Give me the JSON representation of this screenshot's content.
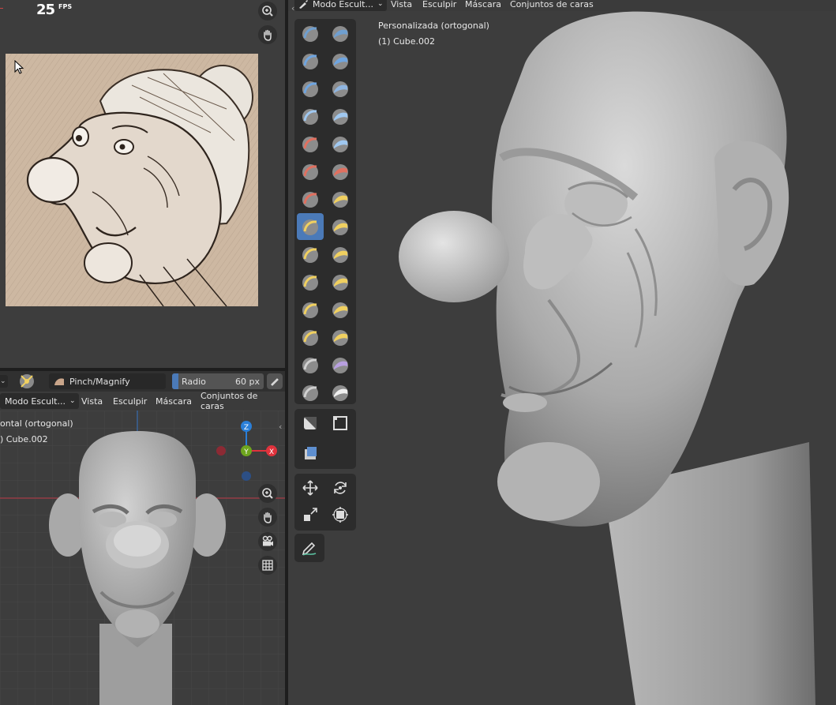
{
  "fps": {
    "value": "25",
    "unit": "FPS"
  },
  "left_bottom": {
    "brush_name": "Pinch/Magnify",
    "radius_label": "Radio",
    "radius_value": "60 px",
    "mode": "Modo Escult...",
    "menu": [
      "Vista",
      "Esculpir",
      "Máscara",
      "Conjuntos de caras"
    ],
    "view_name": "ontal (ortogonal)",
    "object_name": ") Cube.002",
    "gizmo": {
      "z": "Z",
      "y": "Y",
      "x": "X"
    }
  },
  "right": {
    "mode": "Modo Escult...",
    "menu": [
      "Vista",
      "Esculpir",
      "Máscara",
      "Conjuntos de caras"
    ],
    "view_name": "Personalizada (ortogonal)",
    "object_name": "(1) Cube.002"
  },
  "colors": {
    "accent": "#4b7ab8",
    "axis_x": "#e0323c",
    "axis_y": "#6ea51e",
    "axis_z": "#2a7fd8"
  },
  "icons": {
    "zoom": "zoom-icon",
    "hand": "hand-pan-icon",
    "camera": "camera-icon",
    "grid": "grid-icon"
  }
}
